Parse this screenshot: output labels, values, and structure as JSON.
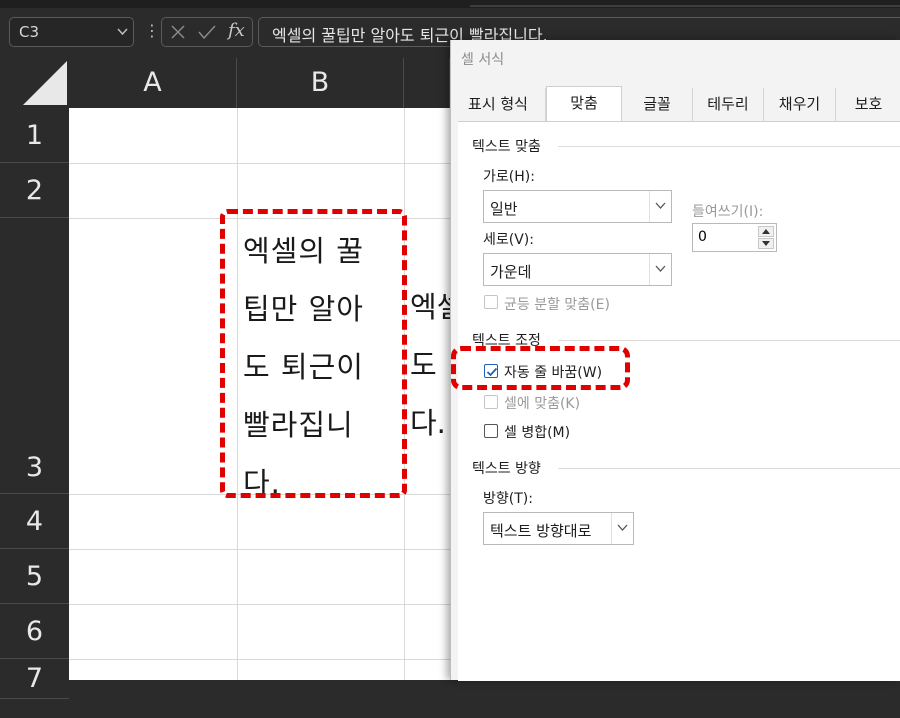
{
  "formula_bar": {
    "name_box": "C3",
    "formula": "엑셀의 꿀팁만 알아도 퇴근이 빨라집니다.",
    "fx_label": "fx"
  },
  "grid": {
    "columns": [
      "A",
      "B"
    ],
    "rows": [
      "1",
      "2",
      "3",
      "4",
      "5",
      "6",
      "7"
    ],
    "cell_b3_lines": [
      "엑셀의 꿀",
      "팁만 알아",
      "도 퇴근이",
      "빨라집니",
      "다."
    ],
    "overflow_c3_lines": [
      "엑셀",
      "도",
      "다."
    ]
  },
  "dialog": {
    "title": "셀 서식",
    "tabs": [
      "표시 형식",
      "맞춤",
      "글꼴",
      "테두리",
      "채우기",
      "보호"
    ],
    "active_tab": "맞춤",
    "text_align_section": "텍스트 맞춤",
    "horizontal_label": "가로(H):",
    "horizontal_value": "일반",
    "indent_label": "들여쓰기(I):",
    "indent_value": "0",
    "vertical_label": "세로(V):",
    "vertical_value": "가운데",
    "justify_distributed": "균등 분할 맞춤(E)",
    "text_control_section": "텍스트 조정",
    "wrap_text": "자동 줄 바꿈(W)",
    "wrap_text_checked": true,
    "shrink_to_fit": "셀에 맞춤(K)",
    "merge_cells": "셀 병합(M)",
    "text_direction_section": "텍스트 방향",
    "direction_label": "방향(T):",
    "direction_value": "텍스트 방향대로"
  },
  "colors": {
    "highlight": "#e00000",
    "check_accent": "#1f5fb5"
  }
}
